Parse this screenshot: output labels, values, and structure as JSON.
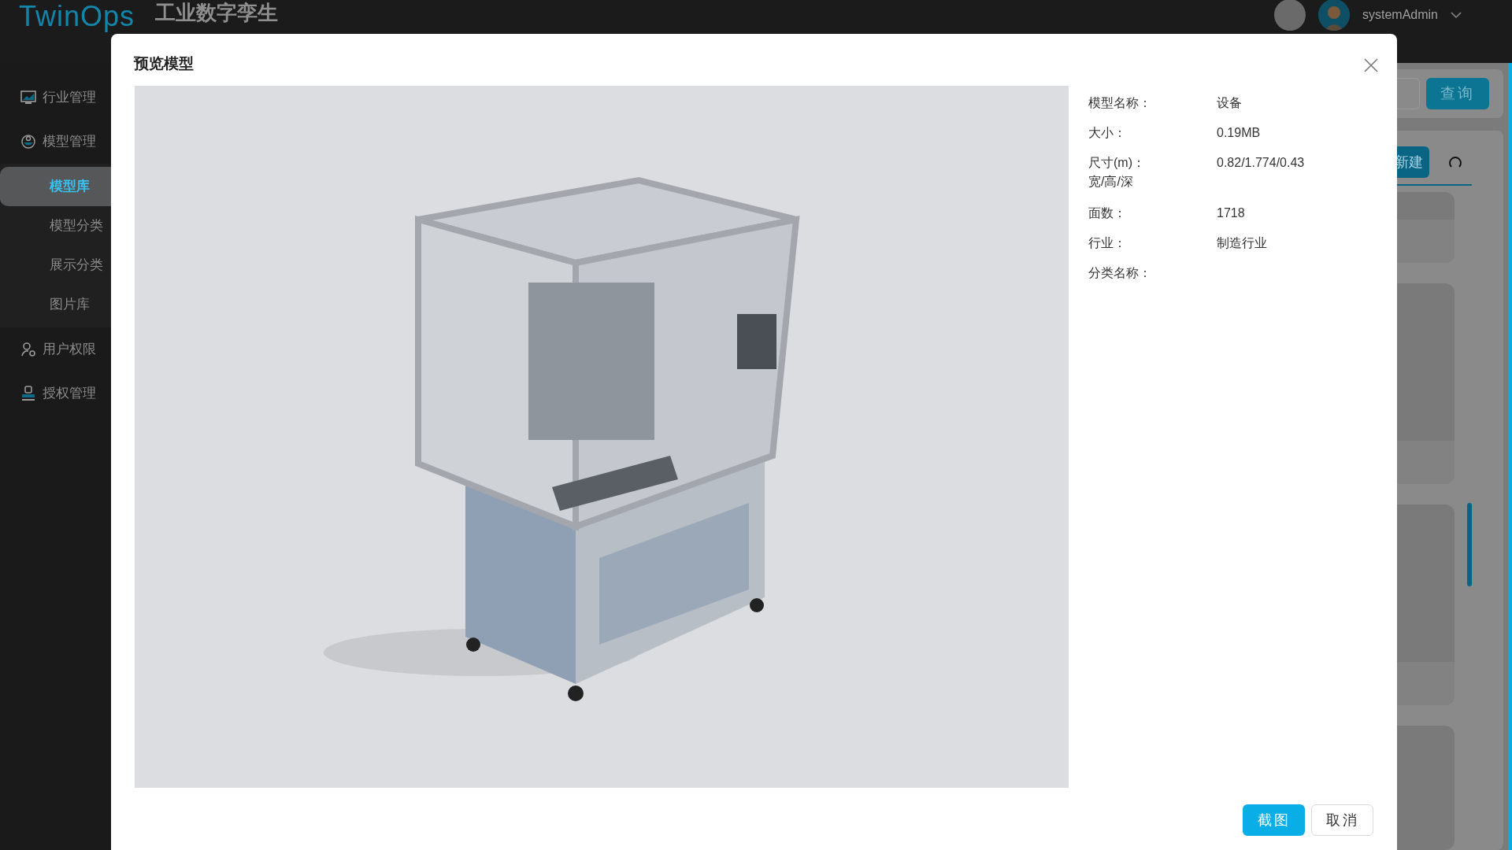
{
  "header": {
    "logo": "TwinOps",
    "title": "工业数字孪生",
    "user": "systemAdmin"
  },
  "sidebar": {
    "items": [
      {
        "label": "行业管理"
      },
      {
        "label": "模型管理",
        "children": [
          {
            "label": "模型库",
            "selected": true
          },
          {
            "label": "模型分类",
            "selected": false
          },
          {
            "label": "展示分类",
            "selected": false
          },
          {
            "label": "图片库",
            "selected": false
          }
        ]
      },
      {
        "label": "用户权限"
      },
      {
        "label": "授权管理"
      }
    ]
  },
  "toolbar": {
    "query_button": "查询",
    "new_button": "新建"
  },
  "modal": {
    "title": "预览模型",
    "info": [
      {
        "label": "模型名称：",
        "value": "设备"
      },
      {
        "label": "大小：",
        "value": "0.19MB"
      },
      {
        "label": "尺寸(m)：",
        "sublabel": "宽/高/深",
        "value": "0.82/1.774/0.43"
      },
      {
        "label": "面数：",
        "value": "1718"
      },
      {
        "label": "行业：",
        "value": "制造行业"
      },
      {
        "label": "分类名称："
      }
    ],
    "buttons": [
      {
        "label": "截图",
        "kind": "primary"
      },
      {
        "label": "取消",
        "kind": "default"
      }
    ]
  }
}
